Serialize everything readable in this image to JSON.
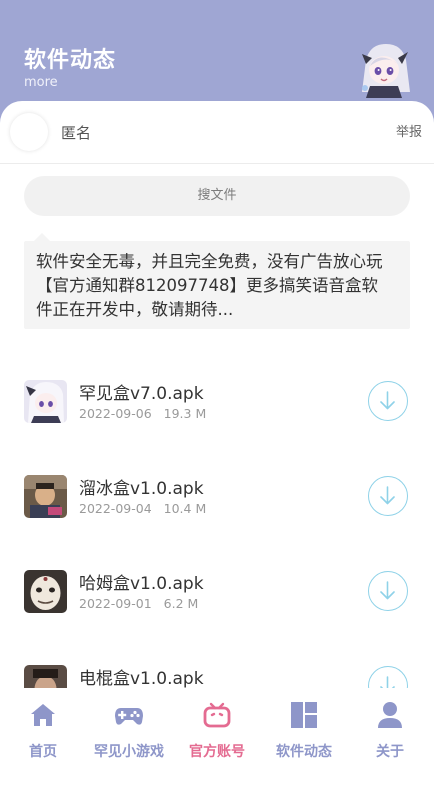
{
  "header": {
    "title": "软件动态",
    "subtitle": "more"
  },
  "post": {
    "author": "匿名",
    "report_label": "举报"
  },
  "search": {
    "placeholder": "搜文件"
  },
  "notice": {
    "text": "软件安全无毒，并且完全免费，没有广告放心玩【官方通知群812097748】更多搞笑语音盒软件正在开发中，敬请期待..."
  },
  "files": [
    {
      "name": "罕见盒v7.0.apk",
      "date": "2022-09-06",
      "size": "19.3 M"
    },
    {
      "name": "溜冰盒v1.0.apk",
      "date": "2022-09-04",
      "size": "10.4 M"
    },
    {
      "name": "哈姆盒v1.0.apk",
      "date": "2022-09-01",
      "size": "6.2 M"
    },
    {
      "name": "电棍盒v1.0.apk",
      "date": "",
      "size": ""
    }
  ],
  "tabbar": {
    "items": [
      {
        "label": "首页",
        "icon": "home-icon"
      },
      {
        "label": "罕见小游戏",
        "icon": "gamepad-icon"
      },
      {
        "label": "官方账号",
        "icon": "tv-icon"
      },
      {
        "label": "软件动态",
        "icon": "dashboard-icon"
      },
      {
        "label": "关于",
        "icon": "user-icon"
      }
    ],
    "active_index": 2
  },
  "colors": {
    "header_bg": "#9fa6d3",
    "tab_inactive": "#8e96c9",
    "tab_active": "#e46b91",
    "download_ring": "#8fd2e8"
  }
}
